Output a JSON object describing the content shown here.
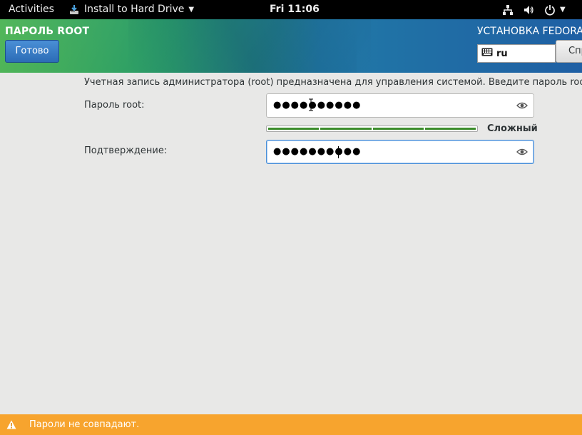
{
  "topbar": {
    "activities": "Activities",
    "app_menu": "Install to Hard Drive",
    "clock": "Fri 11:06",
    "icons": [
      "network-wired-icon",
      "volume-icon",
      "power-icon"
    ]
  },
  "header": {
    "title": "ПАРОЛЬ ROOT",
    "done_label": "Готово",
    "install_title": "УСТАНОВКА FEDORA",
    "keyboard_layout": "ru",
    "help_label": "Справка!"
  },
  "form": {
    "intro": "Учетная запись администратора (root) предназначена для управления системой. Введите пароль root.",
    "root_password_label": "Пароль root:",
    "root_password_mask": "●●●●●●●●●●",
    "strength": 1.0,
    "strength_label": "Сложный",
    "confirm_label": "Подтверждение:",
    "confirm_password_mask": "●●●●●●●●●●"
  },
  "warning": {
    "message": "Пароли не совпадают."
  },
  "colors": {
    "header_green": "#3fae49",
    "header_blue": "#1f5fa4",
    "strength_green": "#3b8c2b",
    "warning_orange": "#f7a42e",
    "focus_blue": "#4a90d9"
  }
}
